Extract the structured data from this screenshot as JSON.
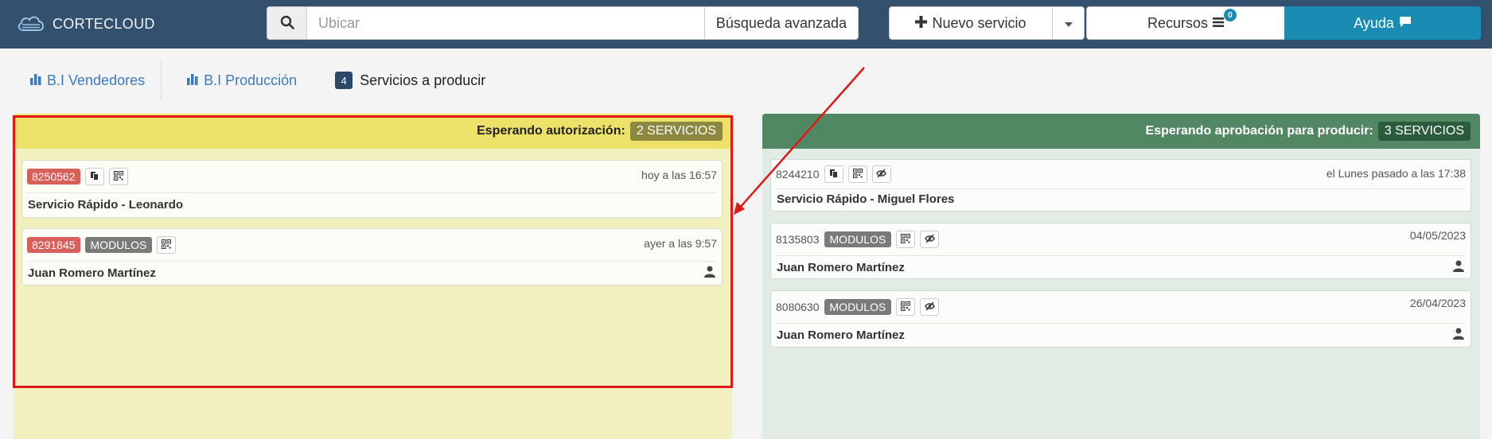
{
  "app": {
    "brand": "CORTECLOUD"
  },
  "search": {
    "placeholder": "Ubicar",
    "advanced_label": "Búsqueda avanzada"
  },
  "toolbar": {
    "new_service_label": "Nuevo servicio",
    "resources_label": "Recursos",
    "resources_badge": "0",
    "help_label": "Ayuda"
  },
  "tabs": [
    {
      "label": "B.I Vendedores"
    },
    {
      "label": "B.I Producción"
    },
    {
      "label": "Servicios a producir",
      "count": "4"
    }
  ],
  "columns": {
    "left": {
      "title": "Esperando autorización:",
      "badge": "2 SERVICIOS",
      "cards": [
        {
          "id": "8250562",
          "time": "hoy a las 16:57",
          "name": "Servicio Rápido - Leonardo"
        },
        {
          "id": "8291845",
          "tag": "MODULOS",
          "time": "ayer a las 9:57",
          "name": "Juan Romero Martínez"
        }
      ]
    },
    "right": {
      "title": "Esperando aprobación para producir:",
      "badge": "3 SERVICIOS",
      "cards": [
        {
          "id": "8244210",
          "time": "el Lunes pasado a las 17:38",
          "name": "Servicio Rápido - Miguel Flores"
        },
        {
          "id": "8135803",
          "tag": "MODULOS",
          "time": "04/05/2023",
          "name": "Juan Romero Martínez"
        },
        {
          "id": "8080630",
          "tag": "MODULOS",
          "time": "26/04/2023",
          "name": "Juan Romero Martínez"
        }
      ]
    }
  },
  "colors": {
    "navbar": "#33506e",
    "accent": "#1a8bb3",
    "left_header": "#ece26a",
    "right_header": "#528764",
    "id_badge_red": "#d9605a",
    "annotation": "#e01818"
  }
}
